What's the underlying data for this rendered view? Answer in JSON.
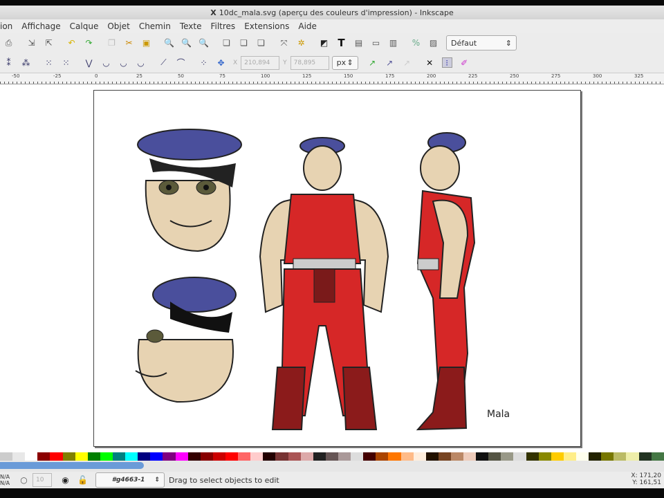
{
  "window": {
    "title": "10dc_mala.svg (aperçu des couleurs d'impression) - Inkscape"
  },
  "menu": [
    "ion",
    "Affichage",
    "Calque",
    "Objet",
    "Chemin",
    "Texte",
    "Filtres",
    "Extensions",
    "Aide"
  ],
  "toolbar": {
    "style_combo": "Défaut",
    "x_label": "X",
    "x_value": "210,894",
    "y_label": "Y",
    "y_value": "78,895",
    "unit": "px"
  },
  "ruler": [
    "-50",
    "-25",
    "0",
    "25",
    "50",
    "75",
    "100",
    "125",
    "150",
    "175",
    "200",
    "225",
    "250",
    "275",
    "300",
    "325"
  ],
  "canvas": {
    "caption": "Mala"
  },
  "palette": [
    "#ccc",
    "#e8e8e8",
    "#fff",
    "#8b0000",
    "#ff0000",
    "#808000",
    "#ffff00",
    "#008000",
    "#00ff00",
    "#008080",
    "#00ffff",
    "#000080",
    "#0000ff",
    "#800080",
    "#ff00ff",
    "#300",
    "#800",
    "#c00",
    "#f00",
    "#f66",
    "#fcc",
    "#200",
    "#733",
    "#a55",
    "#daa",
    "#222",
    "#655",
    "#a99",
    "#ddd",
    "#400",
    "#a40",
    "#f70",
    "#fb8",
    "#fed",
    "#210",
    "#742",
    "#b86",
    "#ecb",
    "#111",
    "#554",
    "#998",
    "#ddd",
    "#330",
    "#880",
    "#fc0",
    "#fe8",
    "#ffe",
    "#220",
    "#770",
    "#bb6",
    "#eea",
    "#232",
    "#474"
  ],
  "status": {
    "layer_top": "N/A",
    "layer_bottom": "N/A",
    "opacity": "10",
    "layer_name": "#g4663-1",
    "message": "Drag to select objects to edit"
  },
  "coords": {
    "x_label": "X:",
    "x": "171,20",
    "y_label": "Y:",
    "y": "161,51"
  }
}
